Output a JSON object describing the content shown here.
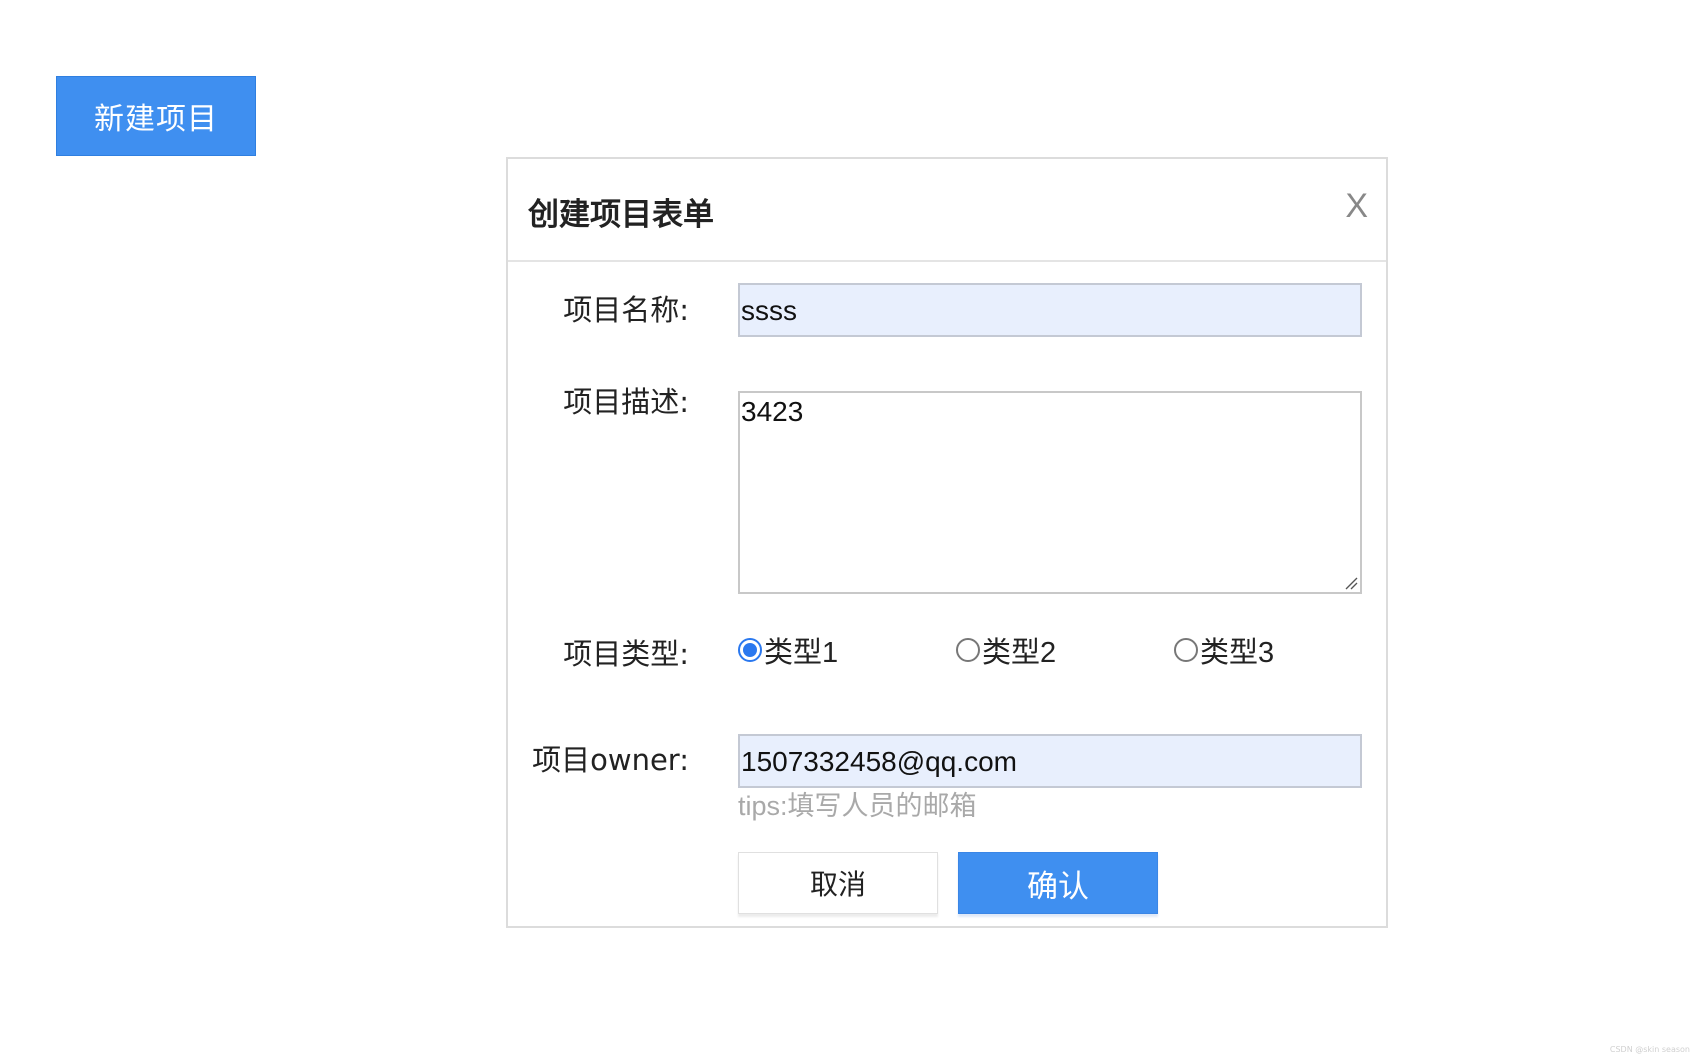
{
  "new_project_button": "新建项目",
  "dialog": {
    "title": "创建项目表单",
    "close_label": "X"
  },
  "form": {
    "name_label": "项目名称:",
    "name_value": "ssss",
    "desc_label": "项目描述:",
    "desc_value": "3423",
    "type_label": "项目类型:",
    "type_options": [
      {
        "label": "类型1",
        "checked": true
      },
      {
        "label": "类型2",
        "checked": false
      },
      {
        "label": "类型3",
        "checked": false
      }
    ],
    "owner_label": "项目owner:",
    "owner_value": "1507332458@qq.com",
    "tips": "tips:填写人员的邮箱"
  },
  "buttons": {
    "cancel": "取消",
    "confirm": "确认"
  },
  "watermark": "CSDN @skin season",
  "colors": {
    "primary": "#3f8ff0",
    "input_fill": "#e8effd",
    "tips_text": "#a9a9a9"
  }
}
